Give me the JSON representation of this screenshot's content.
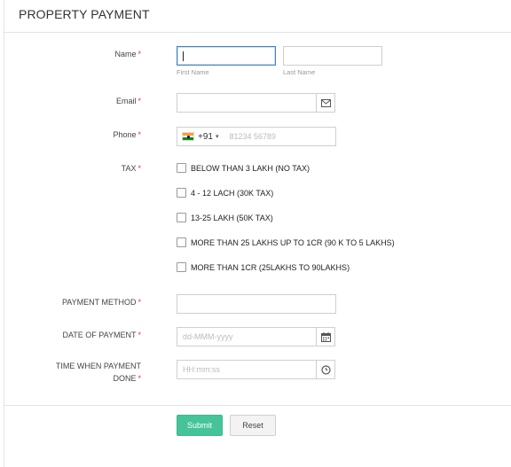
{
  "header": {
    "title": "PROPERTY PAYMENT"
  },
  "fields": {
    "name": {
      "label": "Name",
      "required": "*",
      "first_sublabel": "First Name",
      "last_sublabel": "Last Name",
      "first_value": "",
      "last_value": ""
    },
    "email": {
      "label": "Email",
      "required": "*",
      "value": "",
      "icon": "mail-icon"
    },
    "phone": {
      "label": "Phone",
      "required": "*",
      "country_flag": "india-flag",
      "country_code": "+91",
      "caret": "▾",
      "placeholder": "81234 56789"
    },
    "tax": {
      "label": "TAX",
      "required": "*",
      "options": [
        "BELOW THAN 3 LAKH (NO TAX)",
        "4 - 12 LACH (30K TAX)",
        "13-25 LAKH (50K TAX)",
        "MORE THAN 25 LAKHS UP TO 1CR (90 K TO 5 LAKHS)",
        "MORE THAN 1CR (25LAKHS TO 90LAKHS)"
      ]
    },
    "payment_method": {
      "label": "PAYMENT METHOD",
      "required": "*",
      "value": ""
    },
    "date_of_payment": {
      "label": "DATE OF PAYMENT",
      "required": "*",
      "placeholder": "dd-MMM-yyyy",
      "icon": "calendar-icon"
    },
    "time_of_payment": {
      "label_line1": "TIME WHEN PAYMENT",
      "label_line2": "DONE",
      "required": "*",
      "placeholder": "HH:mm:ss",
      "icon": "clock-icon"
    }
  },
  "actions": {
    "submit_label": "Submit",
    "reset_label": "Reset"
  },
  "colors": {
    "accent": "#45c49a",
    "required": "#e0344b",
    "focus_border": "#3c82c4"
  }
}
